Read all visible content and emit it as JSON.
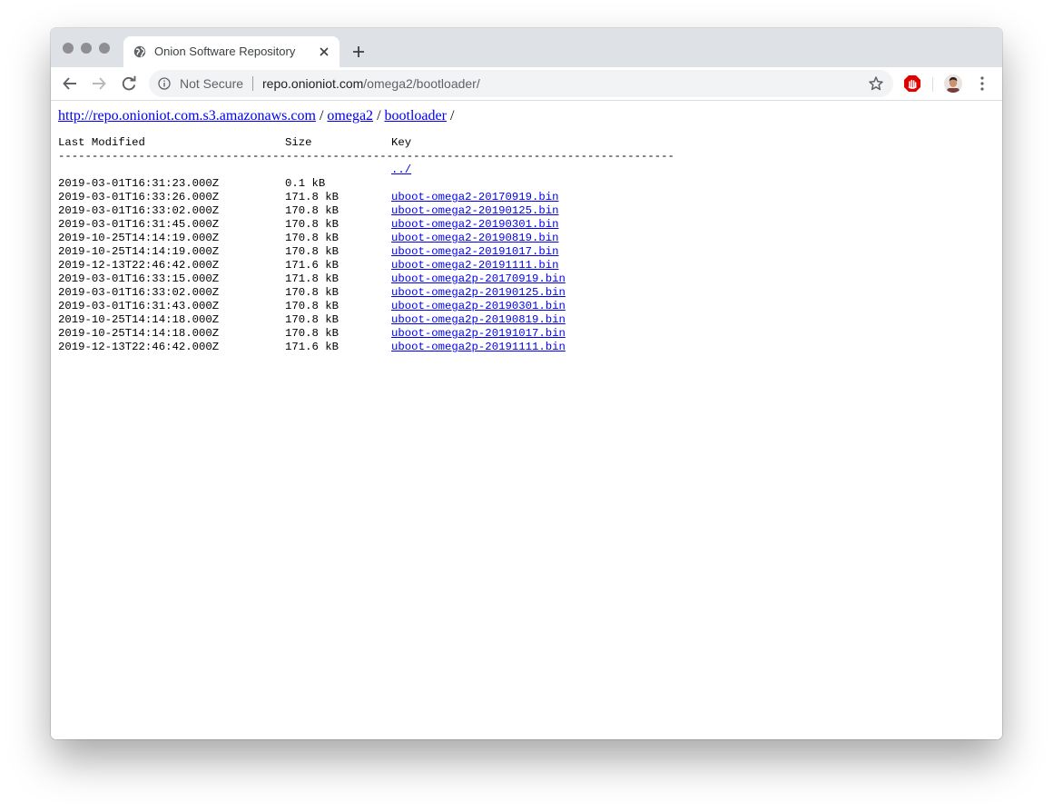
{
  "tab": {
    "title": "Onion Software Repository"
  },
  "omnibox": {
    "security_label": "Not Secure",
    "url_host": "repo.onioniot.com",
    "url_path": "/omega2/bootloader/"
  },
  "breadcrumb": {
    "root": "http://repo.onioniot.com.s3.amazonaws.com",
    "sep1": " / ",
    "dir1": "omega2",
    "sep2": " / ",
    "dir2": "bootloader",
    "sep3": " /"
  },
  "listing": {
    "headers": {
      "modified": "Last Modified",
      "size": "Size",
      "key": "Key"
    },
    "rule": "--------------------------------------------------------------------------------------------",
    "parent_link": "../",
    "rows": [
      {
        "modified": "2019-03-01T16:31:23.000Z",
        "size": "0.1 kB",
        "key": ""
      },
      {
        "modified": "2019-03-01T16:33:26.000Z",
        "size": "171.8 kB",
        "key": "uboot-omega2-20170919.bin"
      },
      {
        "modified": "2019-03-01T16:33:02.000Z",
        "size": "170.8 kB",
        "key": "uboot-omega2-20190125.bin"
      },
      {
        "modified": "2019-03-01T16:31:45.000Z",
        "size": "170.8 kB",
        "key": "uboot-omega2-20190301.bin"
      },
      {
        "modified": "2019-10-25T14:14:19.000Z",
        "size": "170.8 kB",
        "key": "uboot-omega2-20190819.bin"
      },
      {
        "modified": "2019-10-25T14:14:19.000Z",
        "size": "170.8 kB",
        "key": "uboot-omega2-20191017.bin"
      },
      {
        "modified": "2019-12-13T22:46:42.000Z",
        "size": "171.6 kB",
        "key": "uboot-omega2-20191111.bin"
      },
      {
        "modified": "2019-03-01T16:33:15.000Z",
        "size": "171.8 kB",
        "key": "uboot-omega2p-20170919.bin"
      },
      {
        "modified": "2019-03-01T16:33:02.000Z",
        "size": "170.8 kB",
        "key": "uboot-omega2p-20190125.bin"
      },
      {
        "modified": "2019-03-01T16:31:43.000Z",
        "size": "170.8 kB",
        "key": "uboot-omega2p-20190301.bin"
      },
      {
        "modified": "2019-10-25T14:14:18.000Z",
        "size": "170.8 kB",
        "key": "uboot-omega2p-20190819.bin"
      },
      {
        "modified": "2019-10-25T14:14:18.000Z",
        "size": "170.8 kB",
        "key": "uboot-omega2p-20191017.bin"
      },
      {
        "modified": "2019-12-13T22:46:42.000Z",
        "size": "171.6 kB",
        "key": "uboot-omega2p-20191111.bin"
      }
    ]
  },
  "icons": {
    "favicon": "globe-icon",
    "close": "close-icon",
    "new_tab": "plus-icon",
    "back": "back-arrow-icon",
    "forward": "forward-arrow-icon",
    "reload": "reload-icon",
    "info": "info-icon",
    "bookmark": "star-icon",
    "extension": "adblock-stop-icon",
    "profile": "profile-avatar",
    "menu": "kebab-menu-icon"
  },
  "colors": {
    "link": "#0000ee",
    "tabstrip": "#dee1e6",
    "omnibox": "#f1f3f4",
    "extension": "#e10000"
  }
}
